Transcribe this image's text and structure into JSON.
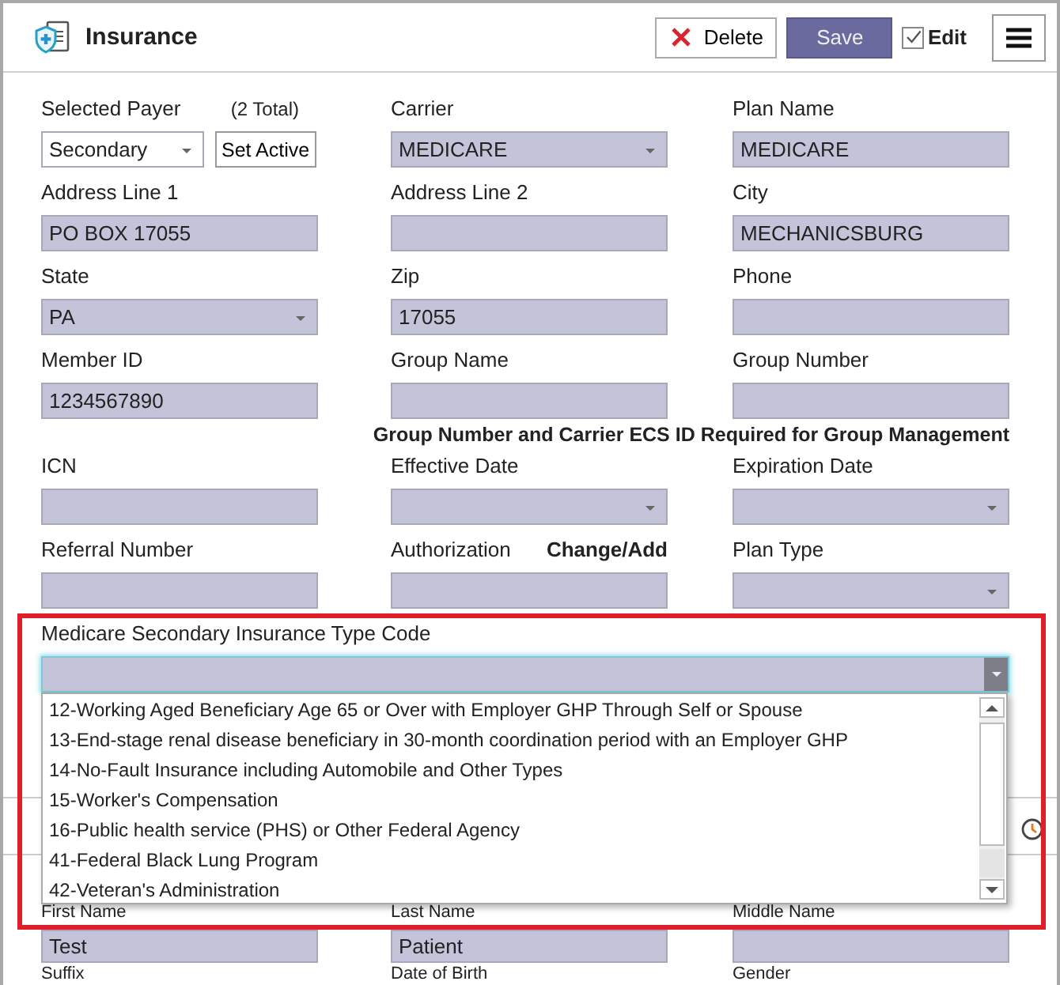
{
  "header": {
    "title": "Insurance",
    "delete_label": "Delete",
    "save_label": "Save",
    "edit": {
      "label": "Edit",
      "checked": true
    }
  },
  "rows": [
    {
      "kind": "fields",
      "fields": [
        {
          "kind": "payer",
          "label": "Selected Payer",
          "count": "(2 Total)",
          "value": "Secondary",
          "button": "Set Active",
          "readonly": false
        },
        {
          "kind": "select",
          "label": "Carrier",
          "value": "MEDICARE",
          "readonly": true
        },
        {
          "kind": "text",
          "label": "Plan Name",
          "value": "MEDICARE",
          "readonly": true
        }
      ]
    },
    {
      "kind": "fields",
      "fields": [
        {
          "kind": "text",
          "label": "Address Line 1",
          "value": "PO BOX 17055",
          "readonly": true
        },
        {
          "kind": "text",
          "label": "Address Line 2",
          "readonly": true
        },
        {
          "kind": "text",
          "label": "City",
          "value": "MECHANICSBURG",
          "readonly": true
        }
      ]
    },
    {
      "kind": "fields",
      "fields": [
        {
          "kind": "select",
          "label": "State",
          "value": "PA",
          "readonly": true
        },
        {
          "kind": "text",
          "label": "Zip",
          "value": "17055",
          "readonly": true
        },
        {
          "kind": "text",
          "label": "Phone",
          "readonly": true
        }
      ]
    },
    {
      "kind": "fields",
      "fields": [
        {
          "kind": "text",
          "label": "Member ID",
          "value": "1234567890",
          "readonly": true
        },
        {
          "kind": "text",
          "label": "Group Name",
          "readonly": true
        },
        {
          "kind": "text",
          "label": "Group Number",
          "readonly": true
        }
      ]
    },
    {
      "kind": "note",
      "text": "Group Number and Carrier ECS ID Required for Group Management"
    },
    {
      "kind": "fields",
      "fields": [
        {
          "kind": "text",
          "label": "ICN",
          "readonly": true
        },
        {
          "kind": "select",
          "label": "Effective Date",
          "readonly": true
        },
        {
          "kind": "select",
          "label": "Expiration Date",
          "readonly": true
        }
      ]
    },
    {
      "kind": "fields",
      "fields": [
        {
          "kind": "text",
          "label": "Referral Number",
          "readonly": true
        },
        {
          "kind": "text",
          "label": "Authorization",
          "link": "Change/Add",
          "readonly": true
        },
        {
          "kind": "select",
          "label": "Plan Type",
          "readonly": true
        }
      ]
    }
  ],
  "msp": {
    "label": "Medicare Secondary Insurance Type Code",
    "open": true,
    "options": [
      {
        "label": "12-Working Aged Beneficiary Age 65 or Over with Employer GHP Through Self or Spouse",
        "selected": false
      },
      {
        "label": "13-End-stage renal disease beneficiary in 30-month coordination period with an Employer GHP",
        "selected": false
      },
      {
        "label": "14-No-Fault Insurance including Automobile and Other Types",
        "selected": false
      },
      {
        "label": "15-Worker's Compensation",
        "selected": false
      },
      {
        "label": "16-Public health service (PHS) or Other Federal Agency",
        "selected": false
      },
      {
        "label": "41-Federal Black Lung Program",
        "selected": false
      },
      {
        "label": "42-Veteran's Administration",
        "selected": false
      }
    ]
  },
  "patient_rows": [
    {
      "kind": "fields",
      "fields": [
        {
          "kind": "text",
          "label": "First Name",
          "value": "Test",
          "readonly": true
        },
        {
          "kind": "text",
          "label": "Last Name",
          "value": "Patient",
          "readonly": true
        },
        {
          "kind": "text",
          "label": "Middle Name",
          "readonly": true
        }
      ]
    },
    {
      "kind": "fields",
      "fields": [
        {
          "kind": "label",
          "label": "Suffix"
        },
        {
          "kind": "label",
          "label": "Date of Birth"
        },
        {
          "kind": "label",
          "label": "Gender"
        }
      ]
    }
  ]
}
